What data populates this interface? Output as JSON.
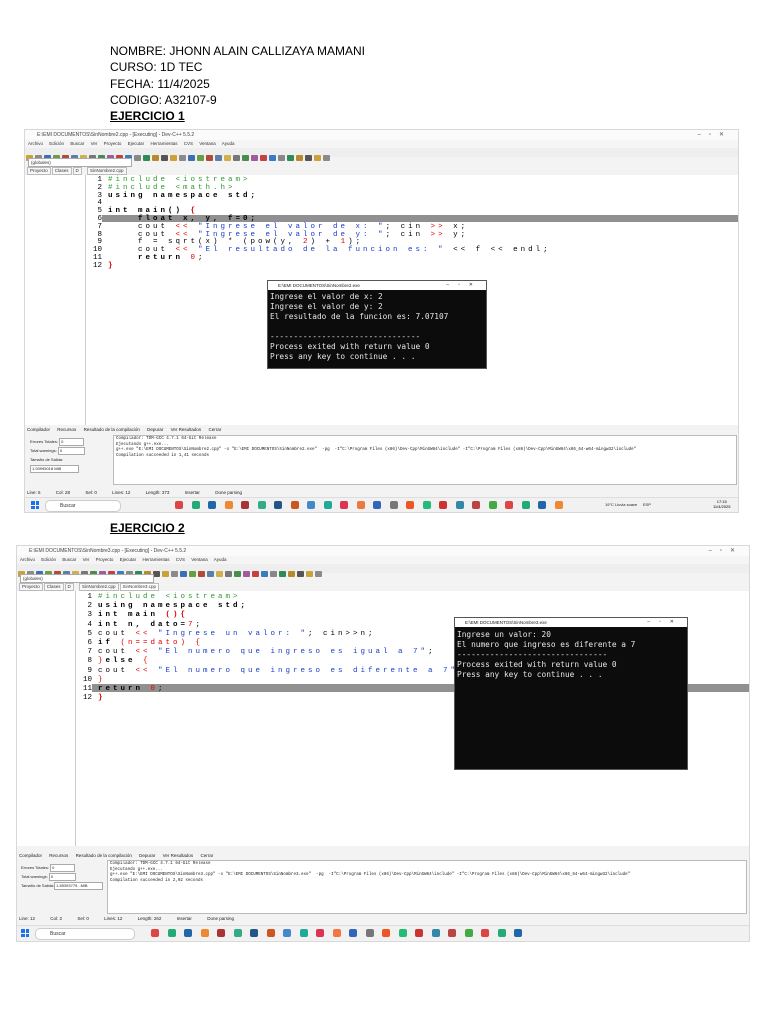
{
  "header": {
    "nombre": "NOMBRE:  JHONN ALAIN CALLIZAYA MAMANI",
    "curso": "CURSO: 1D TEC",
    "fecha": "FECHA: 11/4/2025",
    "codigo": "CODIGO: A32107-9"
  },
  "ex1": {
    "title": "EJERCICIO 1",
    "window_title": "E:\\EMI DOCUMENTOS\\SinNombre2.cpp - [Executing] - Dev-C++ 5.5.2",
    "menu": [
      "Archivo",
      "Edición",
      "Buscar",
      "Ver",
      "Proyecto",
      "Ejecutar",
      "Herramientas",
      "CVS",
      "Ventana",
      "Ayuda"
    ],
    "combo_globals": "(globales)",
    "left_tabs": [
      "Proyecto",
      "Clases",
      "D"
    ],
    "file_tab": "SinNombre2.cpp",
    "line_numbers": [
      "1",
      "2",
      "3",
      "4",
      "5",
      "6",
      "7",
      "8",
      "9",
      "10",
      "11",
      "12"
    ],
    "code": [
      [
        {
          "t": "#include <iostream>",
          "c": "#2d9a2d"
        }
      ],
      [
        {
          "t": "#include <math.h>",
          "c": "#2d9a2d"
        }
      ],
      [
        {
          "t": "using namespace std;",
          "c": "#000000",
          "b": true
        }
      ],
      [
        {
          "t": "",
          "c": "#000"
        }
      ],
      [
        {
          "t": "int main() ",
          "c": "#000",
          "b": true
        },
        {
          "t": "{",
          "c": "#e00000",
          "b": true
        }
      ],
      [
        {
          "t": "    float x, y, f=0;",
          "c": "#000000",
          "b": true
        }
      ],
      [
        {
          "t": "    cout ",
          "c": "#000"
        },
        {
          "t": "<< ",
          "c": "#e00000"
        },
        {
          "t": "\"Ingrese el valor de x: \"",
          "c": "#1a3cc8"
        },
        {
          "t": "; cin ",
          "c": "#000"
        },
        {
          "t": ">> ",
          "c": "#e00000"
        },
        {
          "t": "x;",
          "c": "#000"
        }
      ],
      [
        {
          "t": "    cout ",
          "c": "#000"
        },
        {
          "t": "<< ",
          "c": "#e00000"
        },
        {
          "t": "\"Ingrese el valor de y: \"",
          "c": "#1a3cc8"
        },
        {
          "t": "; cin ",
          "c": "#000"
        },
        {
          "t": ">> ",
          "c": "#e00000"
        },
        {
          "t": "y;",
          "c": "#000"
        }
      ],
      [
        {
          "t": "    f = sqrt(x) * (pow(y, ",
          "c": "#000"
        },
        {
          "t": "2",
          "c": "#e00000"
        },
        {
          "t": ") + ",
          "c": "#000"
        },
        {
          "t": "1",
          "c": "#e00000"
        },
        {
          "t": ");",
          "c": "#000"
        }
      ],
      [
        {
          "t": "    cout ",
          "c": "#000"
        },
        {
          "t": "<< ",
          "c": "#e00000"
        },
        {
          "t": "\"El resultado de la funcion es: \"",
          "c": "#1a3cc8"
        },
        {
          "t": " << f << endl;",
          "c": "#000"
        }
      ],
      [
        {
          "t": "    return ",
          "c": "#000",
          "b": true
        },
        {
          "t": "0",
          "c": "#e00000"
        },
        {
          "t": ";",
          "c": "#000"
        }
      ],
      [
        {
          "t": "}",
          "c": "#e00000",
          "b": true
        }
      ]
    ],
    "console_title": "E:\\EMI DOCUMENTOS\\SinNombre2.exe",
    "console_lines": [
      "Ingrese el valor de x: 2",
      "Ingrese el valor de y: 2",
      "El resultado de la funcion es: 7.07107",
      "",
      "--------------------------------",
      "Process exited with return value 0",
      "Press any key to continue . . ."
    ],
    "bottom_tabs": [
      "Compilador",
      "Recursos",
      "Resultado de la compilación",
      "Depurar",
      "Ver Resultados",
      "Cerrar"
    ],
    "panel_labels": [
      "Errores Totales:",
      "Total warnings:",
      "Tamaño de Salida:"
    ],
    "panel_values": [
      "0",
      "0",
      "1.93995018 MiB"
    ],
    "log_lines": [
      "Compilador: TDM-GCC 4.7.1 64-bit Release",
      "Ejecutando g++.exe...",
      "g++.exe \"E:\\EMI DOCUMENTOS\\SinNombre2.cpp\" -o \"E:\\EMI DOCUMENTOS\\SinNombre2.exe\"  -pg  -I\"C:\\Program Files (x86)\\Dev-Cpp\\MinGW64\\include\" -I\"C:\\Program Files (x86)\\Dev-Cpp\\MinGW64\\x86_64-w64-mingw32\\include\"",
      "Compilation succeeded in 1,41 seconds"
    ],
    "status": [
      "Line:    6",
      "Col:    28",
      "Sel:    0",
      "Lines:    12",
      "Length:    373",
      "Insertar",
      "Done parsing"
    ],
    "taskbar_search": "Buscar",
    "weather": "19°C  Lluvia suave",
    "lang": "ESP",
    "clock_time": "17:15",
    "clock_date": "11/4/2025"
  },
  "ex2": {
    "title": "EJERCICIO 2",
    "window_title": "E:\\EMI DOCUMENTOS\\SinNombre3.cpp - [Executing] - Dev-C++ 5.5.2",
    "menu": [
      "Archivo",
      "Edición",
      "Buscar",
      "Ver",
      "Proyecto",
      "Ejecutar",
      "Herramientas",
      "CVS",
      "Ventana",
      "Ayuda"
    ],
    "combo_globals": "(globales)",
    "left_tabs": [
      "Proyecto",
      "Clases",
      "D"
    ],
    "file_tabs": [
      "SinNombre2.cpp",
      "SinNombre3.cpp"
    ],
    "line_numbers": [
      "1",
      "2",
      "3",
      "4",
      "5",
      "6",
      "7",
      "8",
      "9",
      "10",
      "11",
      "12"
    ],
    "code": [
      [
        {
          "t": "#include <iostream>",
          "c": "#2d9a2d"
        }
      ],
      [
        {
          "t": "using namespace std;",
          "c": "#000",
          "b": true
        }
      ],
      [
        {
          "t": "int main ",
          "c": "#000",
          "b": true
        },
        {
          "t": "(){",
          "c": "#e00000",
          "b": true
        }
      ],
      [
        {
          "t": "int n, dato=",
          "c": "#000",
          "b": true
        },
        {
          "t": "7",
          "c": "#e00000"
        },
        {
          "t": ";",
          "c": "#000"
        }
      ],
      [
        {
          "t": "cout ",
          "c": "#000"
        },
        {
          "t": "<< ",
          "c": "#e00000"
        },
        {
          "t": "\"Ingrese un valor: \"",
          "c": "#1a3cc8"
        },
        {
          "t": "; cin>>n;",
          "c": "#000"
        }
      ],
      [
        {
          "t": "if ",
          "c": "#000",
          "b": true
        },
        {
          "t": "(n==dato) {",
          "c": "#e00000"
        }
      ],
      [
        {
          "t": "cout ",
          "c": "#000"
        },
        {
          "t": "<< ",
          "c": "#e00000"
        },
        {
          "t": "\"El numero que ingreso es igual a 7\"",
          "c": "#1a3cc8"
        },
        {
          "t": ";",
          "c": "#000"
        }
      ],
      [
        {
          "t": "}",
          "c": "#e00000"
        },
        {
          "t": "else ",
          "c": "#000",
          "b": true
        },
        {
          "t": "{",
          "c": "#e00000"
        }
      ],
      [
        {
          "t": "cout ",
          "c": "#000"
        },
        {
          "t": "<< ",
          "c": "#e00000"
        },
        {
          "t": "\"El numero que ingreso es diferente a 7\"",
          "c": "#1a3cc8"
        },
        {
          "t": ";",
          "c": "#000"
        }
      ],
      [
        {
          "t": "}",
          "c": "#e00000"
        }
      ],
      [
        {
          "t": "return ",
          "c": "#000",
          "b": true
        },
        {
          "t": "0",
          "c": "#e00000"
        },
        {
          "t": ";",
          "c": "#000"
        }
      ],
      [
        {
          "t": "}",
          "c": "#e00000",
          "b": true
        }
      ]
    ],
    "console_title": "E:\\EMI DOCUMENTOS\\SinNombre3.exe",
    "console_lines": [
      "Ingrese un valor: 20",
      "El numero que ingreso es diferente a 7",
      "--------------------------------",
      "Process exited with return value 0",
      "Press any key to continue . . ."
    ],
    "bottom_tabs": [
      "Compilador",
      "Recursos",
      "Resultado de la compilación",
      "Depurar",
      "Ver Resultados",
      "Cerrar"
    ],
    "panel_labels": [
      "Errores Totales:",
      "Total warnings:",
      "Tamaño de Salida:"
    ],
    "panel_values": [
      "0",
      "0",
      "1.89393779...MiB"
    ],
    "log_lines": [
      "Compilador: TDM-GCC 4.7.1 64-bit Release",
      "Ejecutando g++.exe...",
      "g++.exe \"E:\\EMI DOCUMENTOS\\SinNombre3.cpp\" -o \"E:\\EMI DOCUMENTOS\\SinNombre3.exe\"  -pg  -I\"C:\\Program Files (x86)\\Dev-Cpp\\MinGW64\\include\" -I\"C:\\Program Files (x86)\\Dev-Cpp\\MinGW64\\x86_64-w64-mingw32\\include\"",
      "Compilation succeeded in 2,02 seconds"
    ],
    "status": [
      "Line:    12",
      "Col:    2",
      "Sel:    0",
      "Lines:    12",
      "Length:    262",
      "Insertar",
      "Done parsing"
    ],
    "taskbar_search": "Buscar"
  }
}
